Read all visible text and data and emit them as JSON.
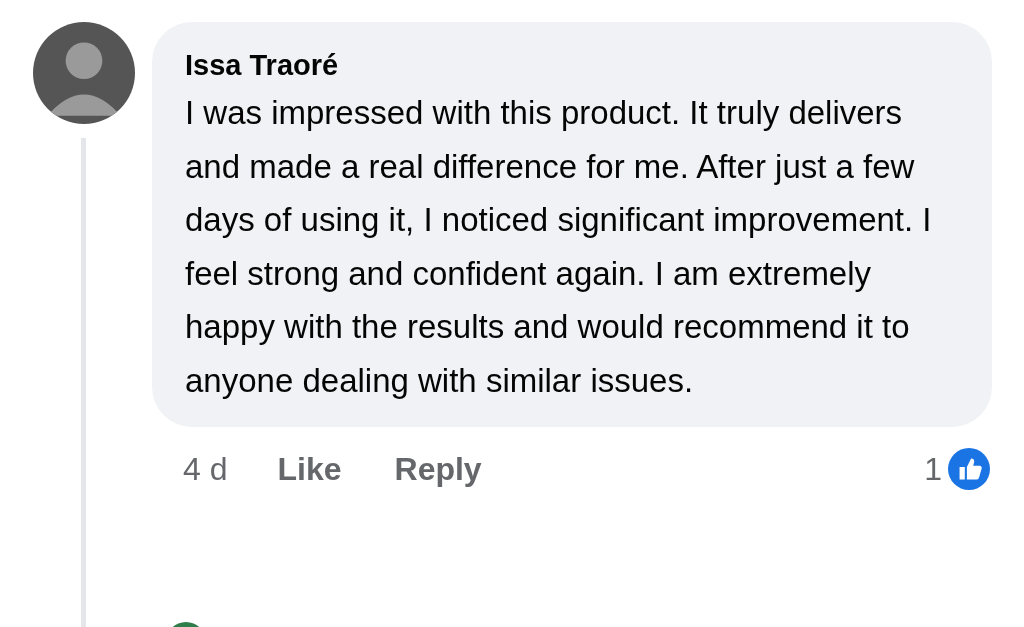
{
  "comment": {
    "author": "Issa Traoré",
    "text": "I was impressed with this product. It truly delivers and made a real difference for me. After just a few days of using it, I noticed significant improvement. I feel strong and confident again. I am extremely happy with the results and would recommend it to anyone dealing with similar issues.",
    "time": "4 d",
    "actions": [
      "Like",
      "Reply"
    ],
    "reaction_count": "1"
  }
}
